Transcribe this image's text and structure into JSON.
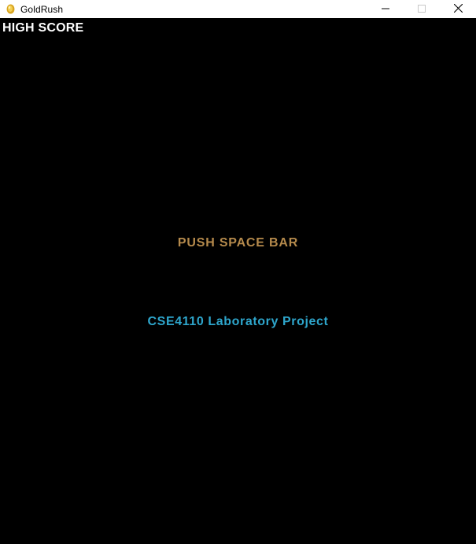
{
  "window": {
    "title": "GoldRush",
    "icon": "gold-coin-icon",
    "controls": [
      "minimize-icon",
      "maximize-icon",
      "close-icon"
    ]
  },
  "game": {
    "high_score_label": "HIGH SCORE",
    "prompt": "PUSH SPACE BAR",
    "credit": "CSE4110 Laboratory Project"
  },
  "colors": {
    "background": "#000000",
    "high_score": "#ffffff",
    "prompt": "#b58a4c",
    "credit": "#2ea6cc"
  }
}
